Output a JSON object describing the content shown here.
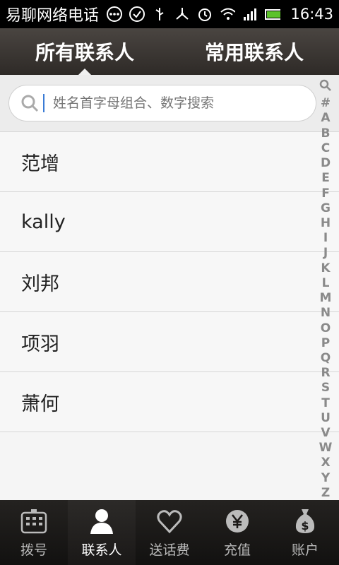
{
  "status": {
    "app_title": "易聊网络电话",
    "time": "16:43"
  },
  "tabs": [
    {
      "label": "所有联系人",
      "active": true
    },
    {
      "label": "常用联系人",
      "active": false
    }
  ],
  "search": {
    "placeholder": "姓名首字母组合、数字搜索"
  },
  "contacts": [
    "范增",
    "kally",
    "刘邦",
    "项羽",
    "萧何"
  ],
  "alphabet": [
    "#",
    "A",
    "B",
    "C",
    "D",
    "E",
    "F",
    "G",
    "H",
    "I",
    "J",
    "K",
    "L",
    "M",
    "N",
    "O",
    "P",
    "Q",
    "R",
    "S",
    "T",
    "U",
    "V",
    "W",
    "X",
    "Y",
    "Z"
  ],
  "bottom_nav": [
    {
      "label": "拨号",
      "icon": "dialpad-icon"
    },
    {
      "label": "联系人",
      "icon": "contact-person-icon"
    },
    {
      "label": "送话费",
      "icon": "heart-icon"
    },
    {
      "label": "充值",
      "icon": "yen-icon"
    },
    {
      "label": "账户",
      "icon": "money-bag-icon"
    }
  ],
  "colors": {
    "accent_cursor": "#3a7bd5",
    "tab_bg": "#3d3935",
    "bottom_bg": "#1a1817"
  }
}
